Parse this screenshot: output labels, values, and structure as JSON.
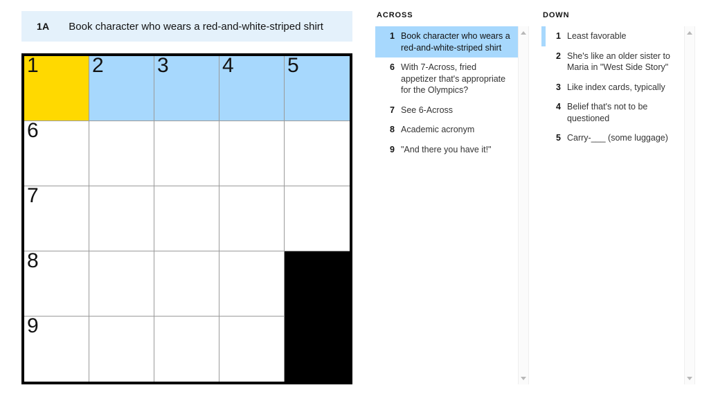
{
  "clue_bar": {
    "label": "1A",
    "text": "Book character who wears a red-and-white-striped shirt"
  },
  "colors": {
    "cursor_cell": "#FFD900",
    "active_word": "#A7D8FD",
    "block": "#000000",
    "clue_bar_bg": "#E4F1FB"
  },
  "grid": {
    "rows": 5,
    "cols": 5,
    "cells": [
      {
        "num": "1",
        "state": "yellow"
      },
      {
        "num": "2",
        "state": "blue"
      },
      {
        "num": "3",
        "state": "blue"
      },
      {
        "num": "4",
        "state": "blue"
      },
      {
        "num": "5",
        "state": "blue"
      },
      {
        "num": "6",
        "state": "empty"
      },
      {
        "num": "",
        "state": "empty"
      },
      {
        "num": "",
        "state": "empty"
      },
      {
        "num": "",
        "state": "empty"
      },
      {
        "num": "",
        "state": "empty"
      },
      {
        "num": "7",
        "state": "empty"
      },
      {
        "num": "",
        "state": "empty"
      },
      {
        "num": "",
        "state": "empty"
      },
      {
        "num": "",
        "state": "empty"
      },
      {
        "num": "",
        "state": "empty"
      },
      {
        "num": "8",
        "state": "empty"
      },
      {
        "num": "",
        "state": "empty"
      },
      {
        "num": "",
        "state": "empty"
      },
      {
        "num": "",
        "state": "empty"
      },
      {
        "num": "",
        "state": "black"
      },
      {
        "num": "9",
        "state": "empty"
      },
      {
        "num": "",
        "state": "empty"
      },
      {
        "num": "",
        "state": "empty"
      },
      {
        "num": "",
        "state": "empty"
      },
      {
        "num": "",
        "state": "black"
      }
    ]
  },
  "across": {
    "heading": "ACROSS",
    "clues": [
      {
        "num": "1",
        "text": "Book character who wears a red-and-white-striped shirt",
        "state": "selected"
      },
      {
        "num": "6",
        "text": "With 7-Across, fried appetizer that's appropriate for the Olympics?",
        "state": "normal"
      },
      {
        "num": "7",
        "text": "See 6-Across",
        "state": "normal"
      },
      {
        "num": "8",
        "text": "Academic acronym",
        "state": "normal"
      },
      {
        "num": "9",
        "text": "\"And there you have it!\"",
        "state": "normal"
      }
    ]
  },
  "down": {
    "heading": "DOWN",
    "clues": [
      {
        "num": "1",
        "text": "Least favorable",
        "state": "marked"
      },
      {
        "num": "2",
        "text": "She's like an older sister to Maria in \"West Side Story\"",
        "state": "normal"
      },
      {
        "num": "3",
        "text": "Like index cards, typically",
        "state": "normal"
      },
      {
        "num": "4",
        "text": "Belief that's not to be questioned",
        "state": "normal"
      },
      {
        "num": "5",
        "text": "Carry-___ (some luggage)",
        "state": "normal"
      }
    ]
  }
}
